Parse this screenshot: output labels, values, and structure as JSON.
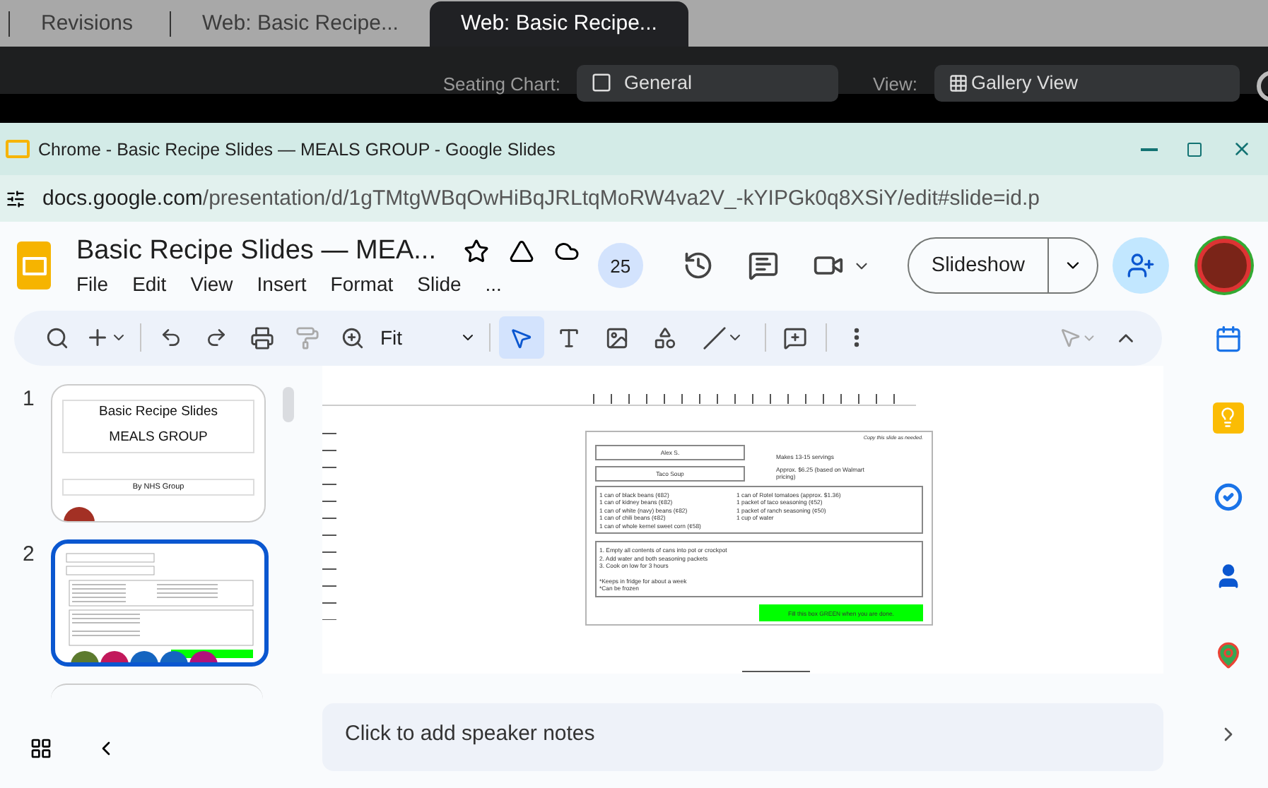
{
  "browser_tabs": [
    {
      "label": "Revisions",
      "selected": false
    },
    {
      "label": "Web: Basic Recipe...",
      "selected": false
    },
    {
      "label": "Web: Basic Recipe...",
      "selected": true
    }
  ],
  "meeting_bar": {
    "seating_label": "Seating Chart:",
    "seating_value": "General",
    "view_label": "View:",
    "view_value": "Gallery View"
  },
  "window": {
    "title": "Chrome - Basic Recipe Slides — MEALS GROUP - Google Slides"
  },
  "address": {
    "host": "docs.google.com",
    "path": "/presentation/d/1gTMtgWBqOwHiBqJRLtqMoRW4va2V_-kYIPGk0q8XSiY/edit#slide=id.p"
  },
  "doc": {
    "title": "Basic Recipe Slides — MEA...",
    "menus": [
      "File",
      "Edit",
      "View",
      "Insert",
      "Format",
      "Slide",
      "..."
    ],
    "viewers": "25",
    "slideshow": "Slideshow"
  },
  "toolbar": {
    "zoom": "Fit",
    "tools": [
      {
        "kind": "select",
        "selected": true
      },
      {
        "kind": "textbox",
        "selected": false
      },
      {
        "kind": "image",
        "selected": false
      },
      {
        "kind": "shape",
        "selected": false
      },
      {
        "kind": "line",
        "selected": false
      }
    ]
  },
  "slides": [
    {
      "number": "1",
      "selected": false,
      "kind": "title",
      "title": "Basic Recipe Slides",
      "subtitle": "MEALS GROUP",
      "byline": "By NHS Group"
    },
    {
      "number": "2",
      "selected": true,
      "kind": "recipe"
    }
  ],
  "slide": {
    "note": "Copy this slide as needed.",
    "name": "Alex S.",
    "recipe": "Taco Soup",
    "servings": "Makes 13-15 servings",
    "cost": "Approx. $6.25 (based on Walmart pricing)",
    "ingredients_left": [
      "1 can of black beans (¢82)",
      "1 can of kidney beans (¢82)",
      "1 can of white (navy) beans (¢82)",
      "1 can of chili beans (¢82)",
      "1 can of whole kernel sweet corn (¢58)"
    ],
    "ingredients_right": [
      "1 can of Rotel tomatoes (approx. $1.36)",
      "1 packet of taco seasoning (¢52)",
      "1 packet of ranch seasoning (¢50)",
      "1 cup of water"
    ],
    "steps": [
      "1. Empty all contents of cans into pot or crockpot",
      "2. Add water and both seasoning packets",
      "3. Cook on low for 3 hours"
    ],
    "tips": [
      "*Keeps in fridge for about a week",
      "*Can be frozen"
    ],
    "done_box": "Fill this box GREEN when you are done."
  },
  "speaker_notes": {
    "placeholder": "Click to add speaker notes"
  }
}
